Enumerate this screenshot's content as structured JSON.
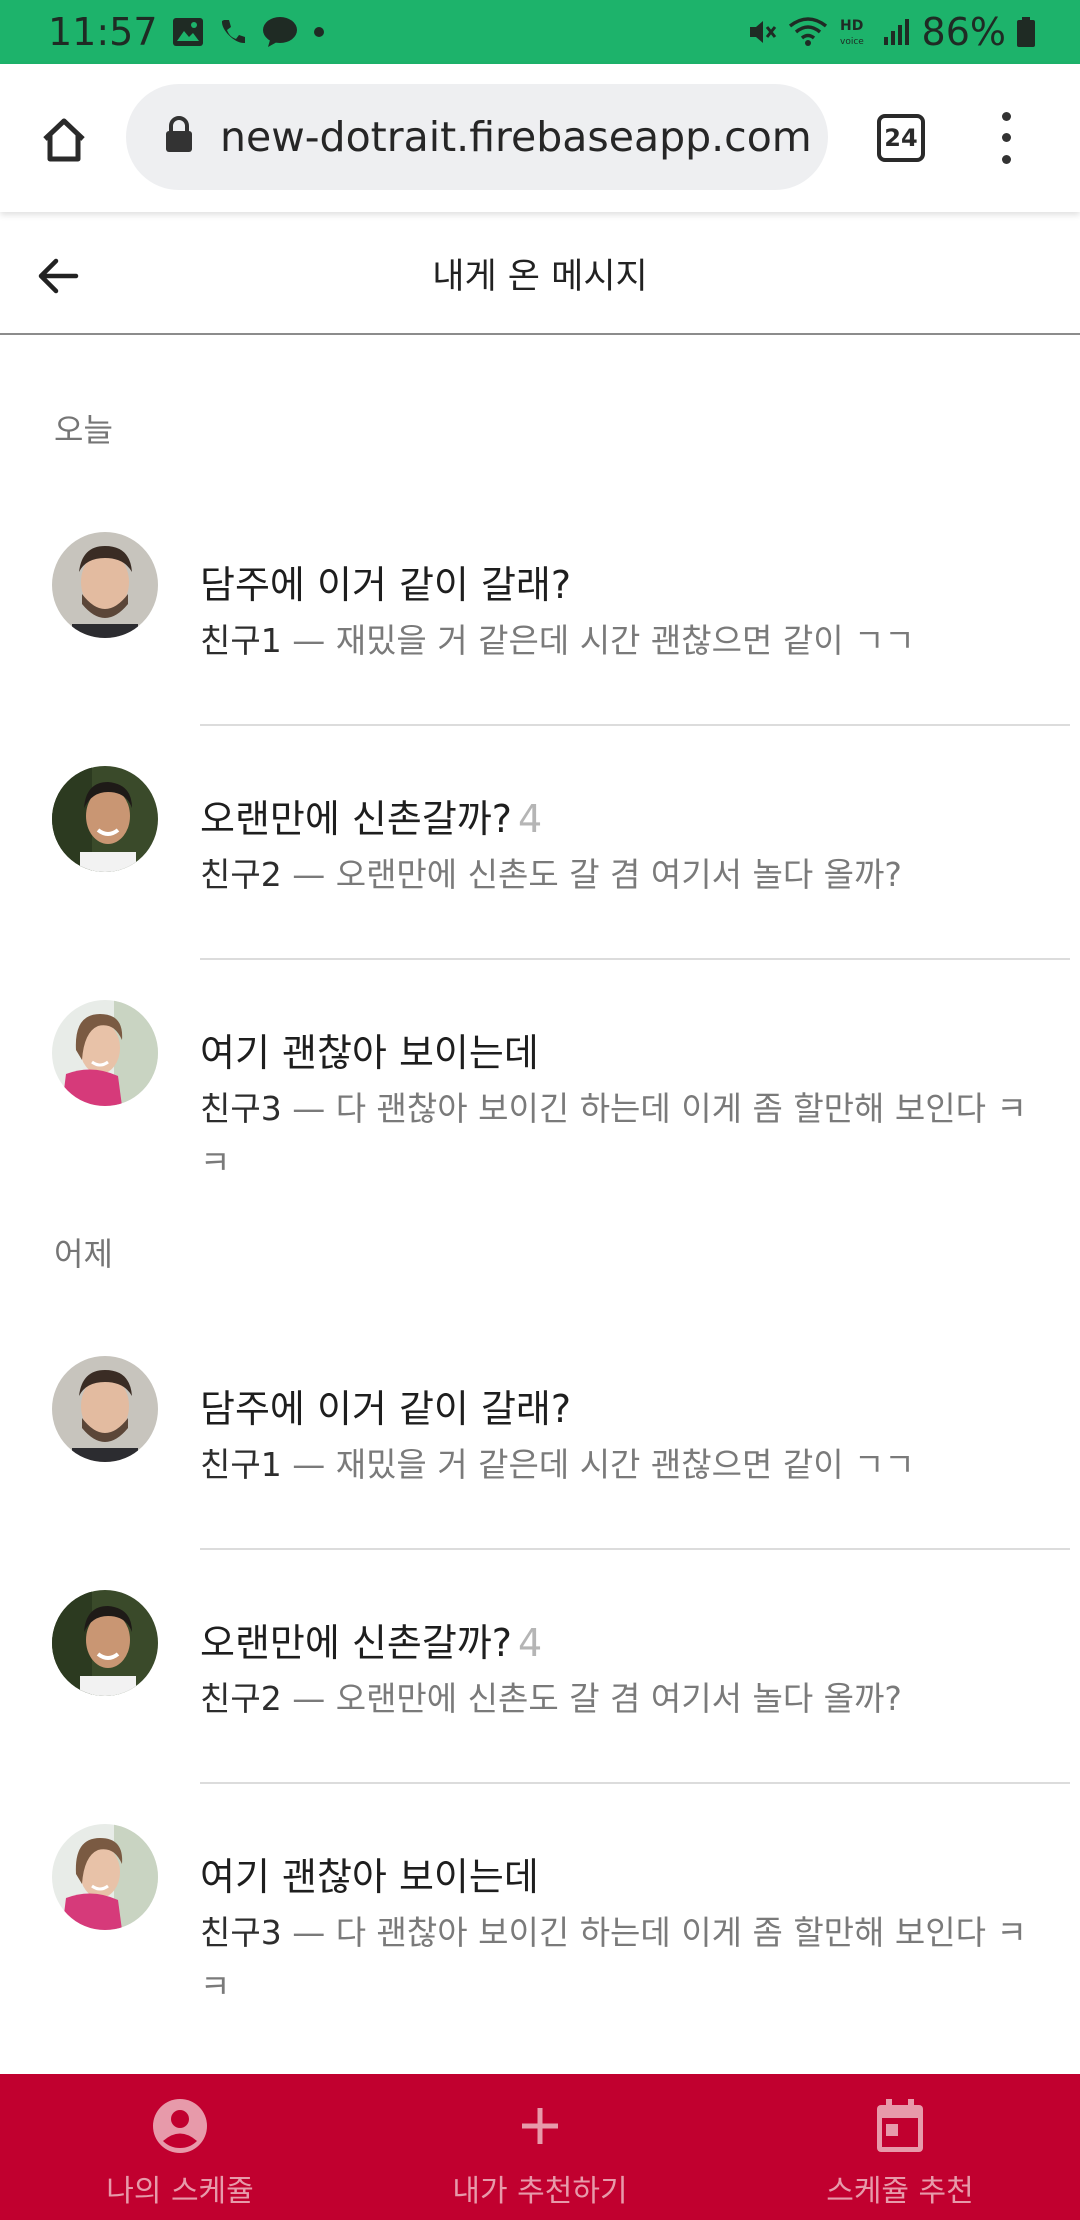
{
  "status_bar": {
    "time": "11:57",
    "battery": "86%"
  },
  "browser": {
    "url": "new-dotrait.firebaseapp.com",
    "tab_count": "24"
  },
  "header": {
    "title": "내게 온 메시지"
  },
  "sections": [
    {
      "label": "오늘",
      "messages": [
        {
          "title": "담주에 이거 같이 갈래?",
          "count": "",
          "sender": "친구1",
          "separator": " — ",
          "preview": "재밌을 거 같은데 시간 괜찮으면 같이 ㄱㄱ"
        },
        {
          "title": "오랜만에 신촌갈까?",
          "count": "4",
          "sender": "친구2",
          "separator": " — ",
          "preview": "오랜만에 신촌도 갈 겸 여기서 놀다 올까?"
        },
        {
          "title": "여기 괜찮아 보이는데",
          "count": "",
          "sender": "친구3",
          "separator": " — ",
          "preview": "다 괜찮아 보이긴 하는데 이게 좀 할만해 보인다 ㅋㅋ"
        }
      ]
    },
    {
      "label": "어제",
      "messages": [
        {
          "title": "담주에 이거 같이 갈래?",
          "count": "",
          "sender": "친구1",
          "separator": " — ",
          "preview": "재밌을 거 같은데 시간 괜찮으면 같이 ㄱㄱ"
        },
        {
          "title": "오랜만에 신촌갈까?",
          "count": "4",
          "sender": "친구2",
          "separator": " — ",
          "preview": "오랜만에 신촌도 갈 겸 여기서 놀다 올까?"
        },
        {
          "title": "여기 괜찮아 보이는데",
          "count": "",
          "sender": "친구3",
          "separator": " — ",
          "preview": "다 괜찮아 보이긴 하는데 이게 좀 할만해 보인다 ㅋㅋ"
        }
      ]
    }
  ],
  "bottom_nav": {
    "items": [
      {
        "label": "나의 스케쥴",
        "icon": "account-circle-icon"
      },
      {
        "label": "내가 추천하기",
        "icon": "plus-icon"
      },
      {
        "label": "스케쥴 추천",
        "icon": "calendar-icon"
      }
    ]
  },
  "colors": {
    "status_bar": "#1db36b",
    "bottom_nav": "#c1002f",
    "nav_inactive": "#e79aaa"
  }
}
